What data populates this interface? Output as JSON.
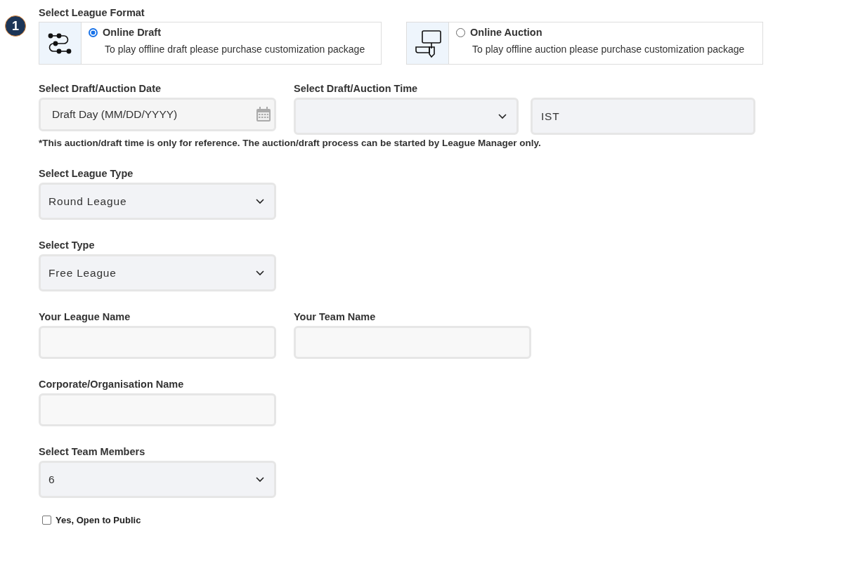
{
  "step_badge": "1",
  "league_format": {
    "label": "Select League Format",
    "options": [
      {
        "kind": "draft",
        "title": "Online Draft",
        "note": "To play offline draft please purchase customization package",
        "selected": true
      },
      {
        "kind": "auction",
        "title": "Online Auction",
        "note": "To play offline auction please purchase customization package",
        "selected": false
      }
    ]
  },
  "schedule": {
    "date_label": "Select Draft/Auction Date",
    "date_placeholder": "Draft Day (MM/DD/YYYY)",
    "time_label": "Select Draft/Auction Time",
    "timezone": "IST",
    "note": "*This auction/draft time is only for reference. The auction/draft process can be started by League Manager only."
  },
  "rows": [
    {
      "fields": [
        {
          "kind": "select",
          "label": "Select League Type",
          "value": "Round League"
        }
      ]
    },
    {
      "fields": [
        {
          "kind": "select",
          "label": "Select Type",
          "value": "Free League"
        }
      ]
    },
    {
      "fields": [
        {
          "kind": "text",
          "label": "Your League Name"
        },
        {
          "kind": "text",
          "label": "Your Team Name"
        }
      ]
    },
    {
      "fields": [
        {
          "kind": "text",
          "label": "Corporate/Organisation Name"
        }
      ]
    },
    {
      "fields": [
        {
          "kind": "select",
          "label": "Select Team Members",
          "value": "6"
        }
      ]
    }
  ],
  "open_to_public": {
    "label": "Yes, Open to Public",
    "checked": false
  }
}
